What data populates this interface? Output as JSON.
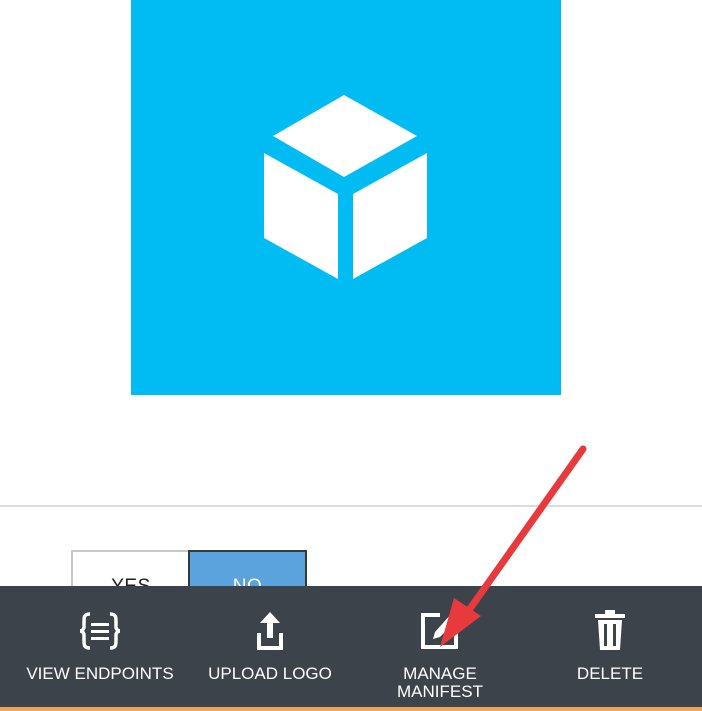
{
  "settings": {
    "toggle": {
      "yes_label": "YES",
      "no_label": "NO",
      "selected": "NO"
    }
  },
  "command_bar": {
    "items": [
      {
        "label": "VIEW ENDPOINTS",
        "icon": "braces-icon"
      },
      {
        "label": "UPLOAD LOGO",
        "icon": "upload-icon"
      },
      {
        "label": "MANAGE\nMANIFEST",
        "icon": "edit-icon"
      },
      {
        "label": "DELETE",
        "icon": "trash-icon"
      }
    ]
  },
  "colors": {
    "logo_tile": "#00bcf2",
    "command_bar": "#3c434a",
    "toggle_selected": "#5aa3dc",
    "annotation_arrow": "#e8393d",
    "accent_edge": "#e8a55b"
  }
}
